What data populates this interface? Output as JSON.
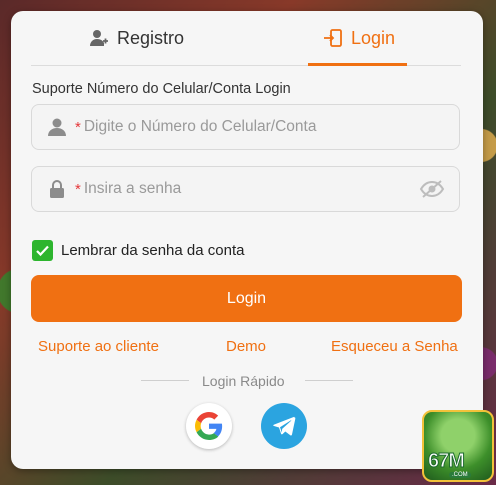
{
  "tabs": {
    "register": "Registro",
    "login": "Login"
  },
  "form": {
    "title": "Suporte Número do Celular/Conta Login",
    "phone_placeholder": "Digite o Número do Celular/Conta",
    "password_placeholder": "Insira a senha",
    "required_mark": "*",
    "remember_label": "Lembrar da senha da conta",
    "remember_checked": true,
    "login_button": "Login"
  },
  "links": {
    "support": "Suporte ao cliente",
    "demo": "Demo",
    "forgot": "Esqueceu a Senha"
  },
  "quick_login": {
    "label": "Login Rápido",
    "providers": [
      "google-icon",
      "telegram-icon"
    ]
  },
  "brand": {
    "logo_text": "67M",
    "logo_sub": ".COM"
  },
  "colors": {
    "accent": "#f07012",
    "check": "#2db52e",
    "telegram": "#2ba4e0"
  }
}
